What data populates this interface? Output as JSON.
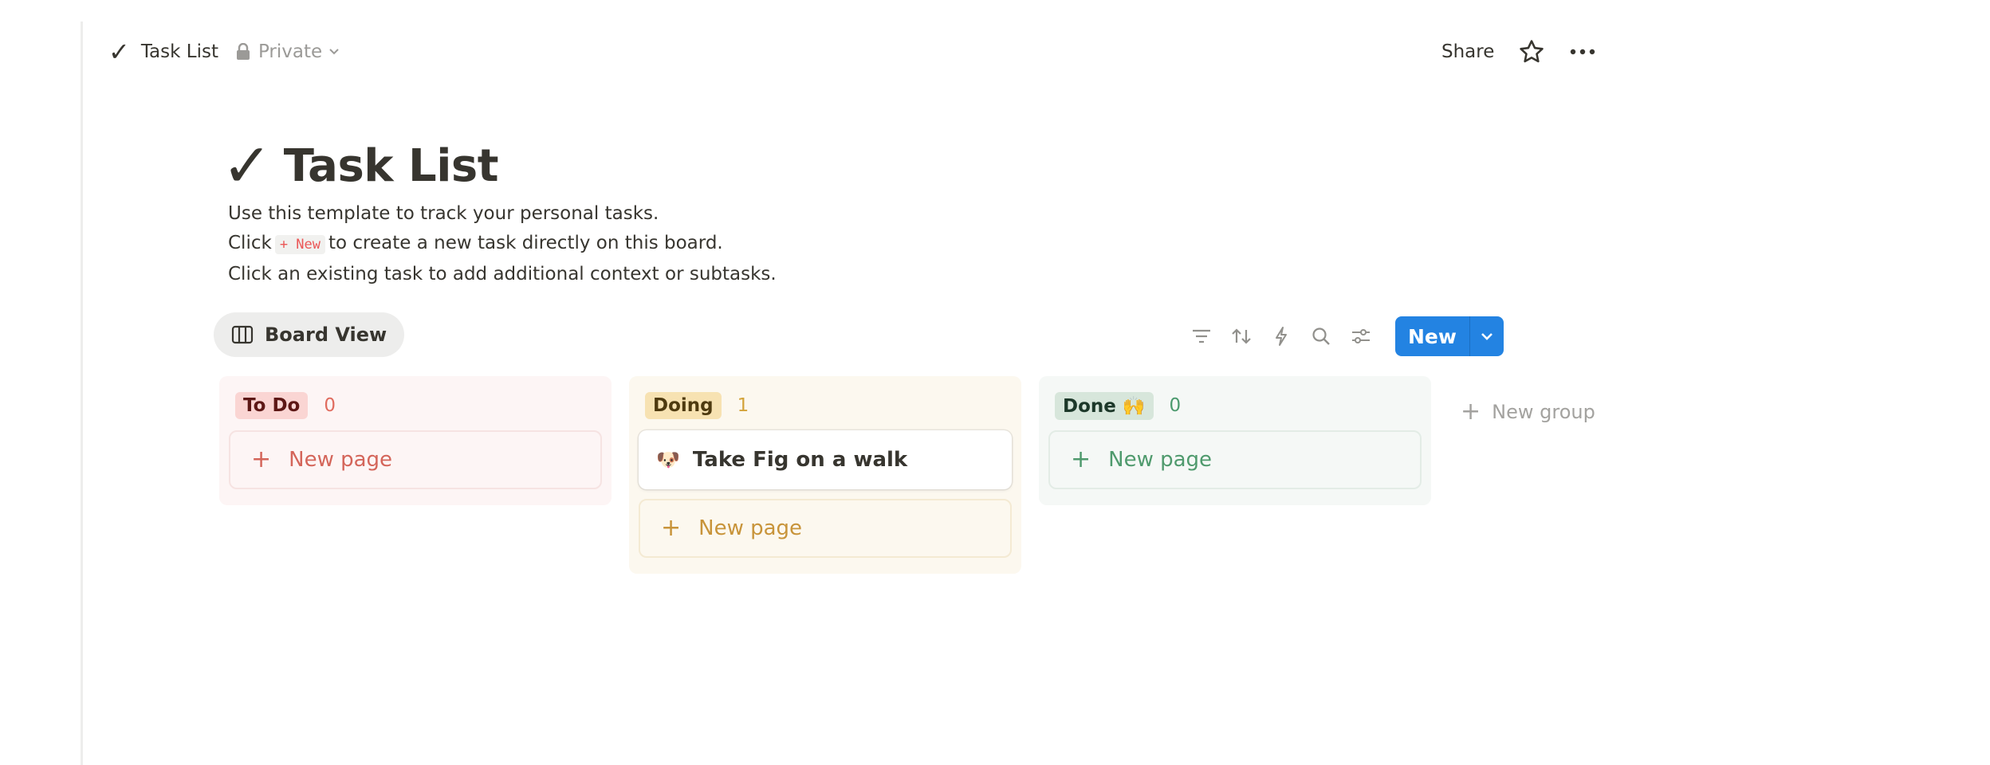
{
  "topbar": {
    "title": "Task List",
    "privacy": "Private",
    "share_label": "Share"
  },
  "page": {
    "title": "Task List",
    "desc_line1": "Use this template to track your personal tasks.",
    "desc_line2_pre": "Click",
    "desc_code": "+ New",
    "desc_line2_post": "to create a new task directly on this board.",
    "desc_line3": "Click an existing task to add additional context or subtasks."
  },
  "view": {
    "tab_label": "Board View",
    "new_label": "New"
  },
  "board": {
    "columns": [
      {
        "name": "To Do",
        "count": "0",
        "new_page_label": "New page"
      },
      {
        "name": "Doing",
        "count": "1",
        "new_page_label": "New page",
        "cards": [
          {
            "emoji": "🐶",
            "title": "Take Fig on a walk"
          }
        ]
      },
      {
        "name": "Done 🙌",
        "count": "0",
        "new_page_label": "New page"
      }
    ],
    "new_group_label": "New group"
  },
  "colors": {
    "accent": "#2383e2",
    "todo": "#fad5d3",
    "doing": "#f7e2b2",
    "done": "#d7e6db"
  },
  "icons": [
    "check-icon",
    "lock-icon",
    "chevron-down-icon",
    "star-icon",
    "more-icon",
    "board-icon",
    "filter-icon",
    "sort-icon",
    "lightning-icon",
    "search-icon",
    "settings-icon",
    "plus-icon"
  ]
}
